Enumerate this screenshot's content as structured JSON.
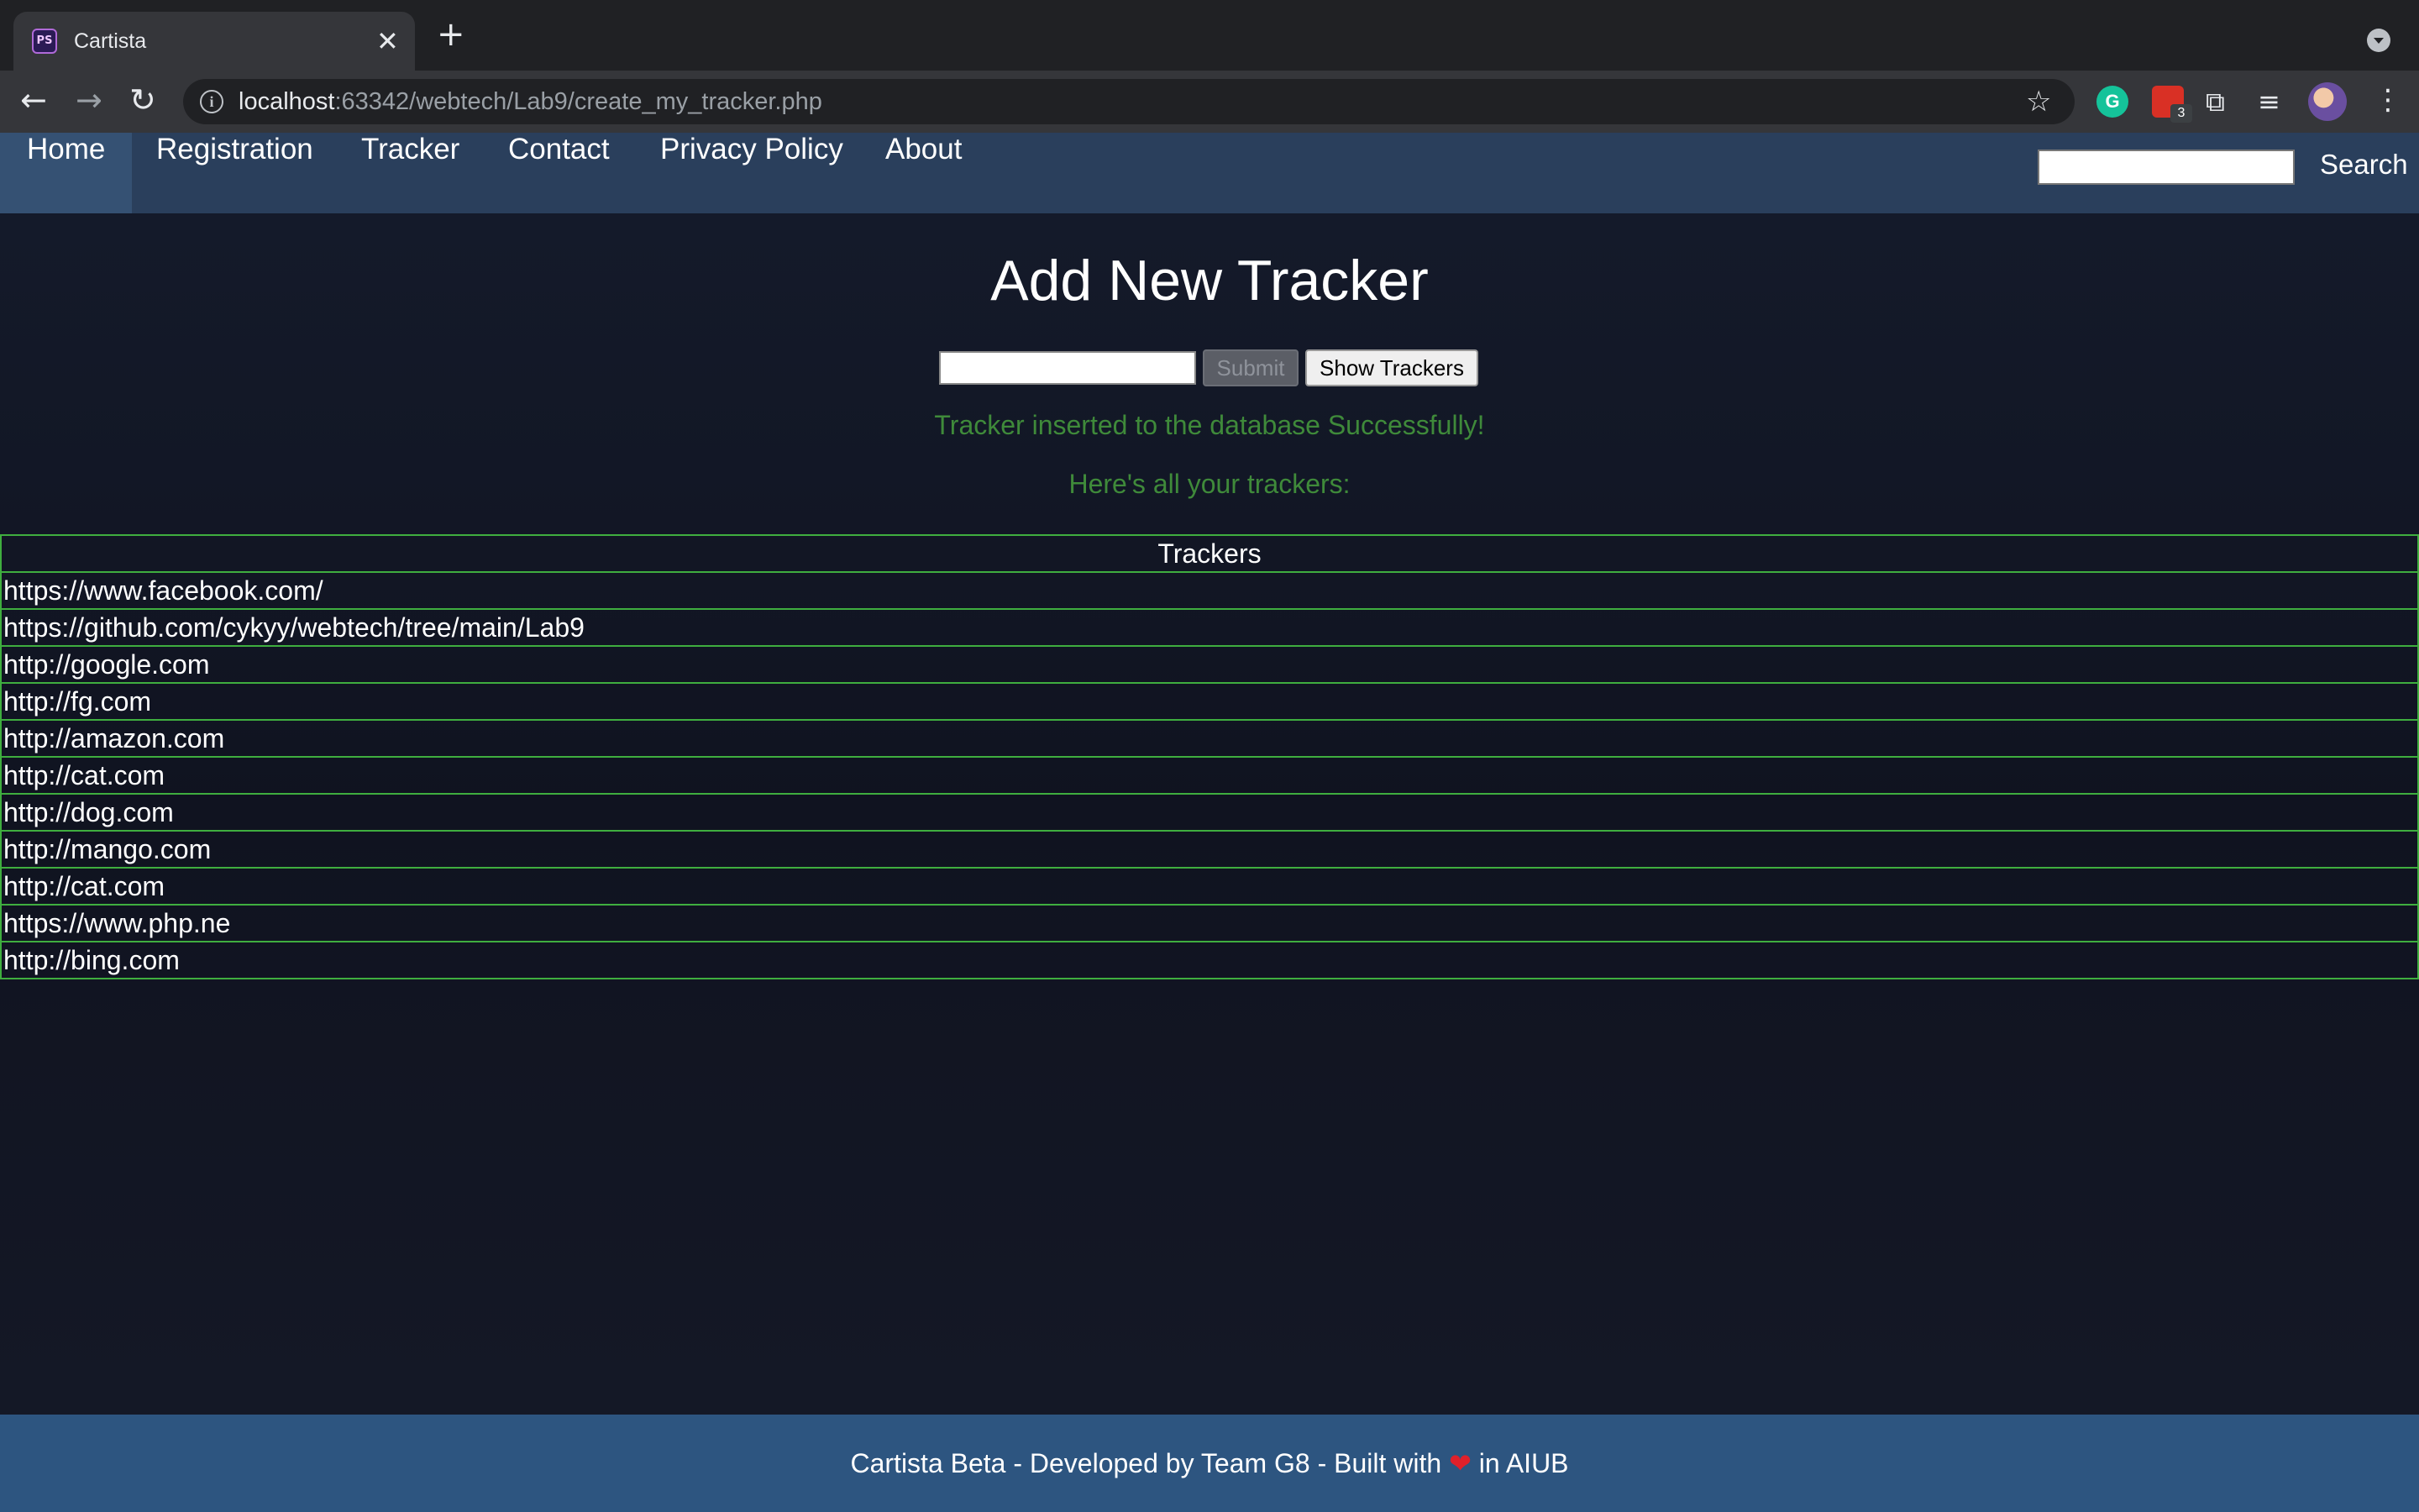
{
  "browser": {
    "tab_title": "Cartista",
    "favicon_text": "PS",
    "close_glyph": "✕",
    "new_tab_glyph": "+",
    "url_host": "localhost",
    "url_rest": ":63342/webtech/Lab9/create_my_tracker.php",
    "extension_badge": "3",
    "grammarly_letter": "G",
    "icons": [
      "back-arrow-icon",
      "forward-arrow-icon",
      "reload-icon",
      "info-icon",
      "star-icon",
      "grammarly-icon",
      "extension-icon",
      "puzzle-icon",
      "media-icon",
      "avatar",
      "menu-icon"
    ]
  },
  "navbar": {
    "items": [
      {
        "label": "Home",
        "active": true
      },
      {
        "label": "Registration"
      },
      {
        "label": "Tracker"
      },
      {
        "label": "Contact"
      },
      {
        "label": "Privacy Policy"
      },
      {
        "label": "About"
      }
    ],
    "search_label": "Search",
    "search_value": ""
  },
  "main": {
    "title": "Add New Tracker",
    "input_value": "",
    "submit_label": "Submit",
    "show_label": "Show Trackers",
    "success_message": "Tracker inserted to the database Successfully!",
    "list_message": "Here's all your trackers:",
    "table_header": "Trackers",
    "trackers": [
      "https://www.facebook.com/",
      "https://github.com/cykyy/webtech/tree/main/Lab9",
      "http://google.com",
      "http://fg.com",
      "http://amazon.com",
      "http://cat.com",
      "http://dog.com",
      "http://mango.com",
      "http://cat.com",
      "https://www.php.ne",
      "http://bing.com"
    ]
  },
  "footer": {
    "text_before": "Cartista Beta - Developed by Team G8 - Built with",
    "heart": "❤",
    "text_after": "in AIUB"
  },
  "colors": {
    "navbar_bg": "#2a3f5c",
    "footer_bg": "#2d5580",
    "message_green": "#3f8a3a",
    "table_border": "#3fae3f",
    "page_bg": "#12141f"
  }
}
